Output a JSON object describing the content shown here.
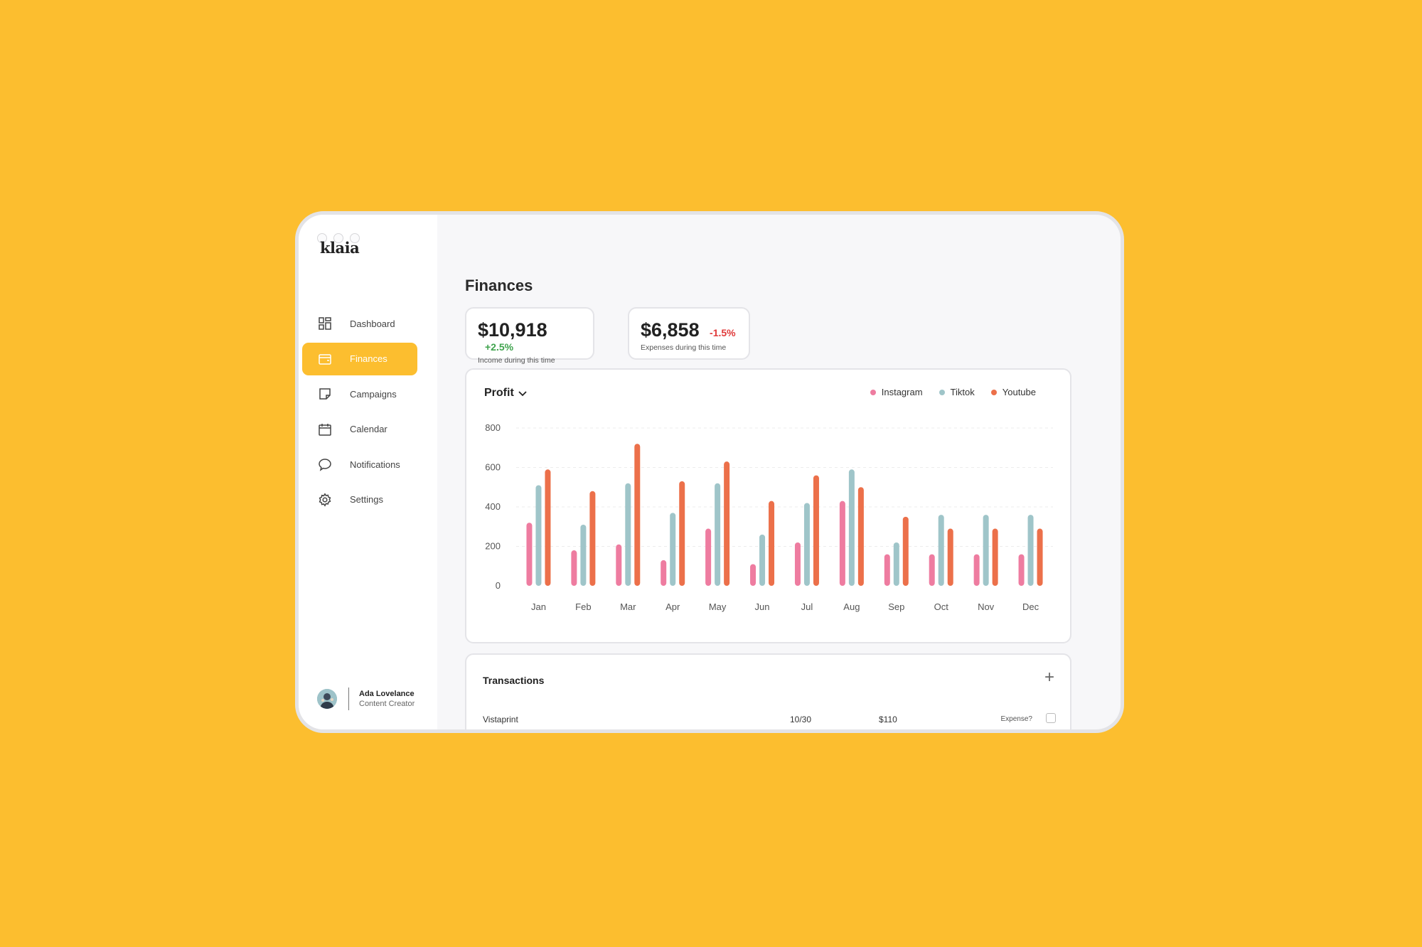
{
  "app": {
    "logo": "klaia"
  },
  "sidebar": {
    "items": [
      {
        "label": "Dashboard",
        "icon": "dashboard-icon"
      },
      {
        "label": "Finances",
        "icon": "wallet-icon",
        "active": true
      },
      {
        "label": "Campaigns",
        "icon": "note-icon"
      },
      {
        "label": "Calendar",
        "icon": "calendar-icon"
      },
      {
        "label": "Notifications",
        "icon": "chat-bubble-icon"
      },
      {
        "label": "Settings",
        "icon": "gear-icon"
      }
    ],
    "user": {
      "name": "Ada Lovelance",
      "role": "Content Creator"
    }
  },
  "main": {
    "title": "Finances",
    "income": {
      "amount": "$10,918",
      "change": "+2.5%",
      "label": "Income during this time"
    },
    "expenses": {
      "amount": "$6,858",
      "change": "-1.5%",
      "label": "Expenses during this time"
    },
    "chart_selector": "Profit",
    "transactions": {
      "title": "Transactions",
      "rows": [
        {
          "name": "Vistaprint",
          "date": "10/30",
          "amount": "$110",
          "expense_label": "Expense?"
        }
      ]
    }
  },
  "colors": {
    "accent": "#FCBE2F",
    "instagram": "#EE7CA0",
    "tiktok": "#9FC5C9",
    "youtube": "#EC704A",
    "positive": "#3FA34D",
    "negative": "#E03A3A"
  },
  "chart_data": {
    "type": "bar",
    "categories": [
      "Jan",
      "Feb",
      "Mar",
      "Apr",
      "May",
      "Jun",
      "Jul",
      "Aug",
      "Sep",
      "Oct",
      "Nov",
      "Dec"
    ],
    "series": [
      {
        "name": "Instagram",
        "values": [
          320,
          180,
          210,
          130,
          290,
          110,
          220,
          430,
          160,
          160,
          160,
          160
        ]
      },
      {
        "name": "Tiktok",
        "values": [
          510,
          310,
          520,
          370,
          520,
          260,
          420,
          590,
          220,
          360,
          360,
          360
        ]
      },
      {
        "name": "Youtube",
        "values": [
          590,
          480,
          720,
          530,
          630,
          430,
          560,
          500,
          350,
          290,
          290,
          290
        ]
      }
    ],
    "ylim": [
      0,
      800
    ],
    "yticks": [
      0,
      200,
      400,
      600,
      800
    ],
    "grid": true,
    "legend": "top-right"
  }
}
